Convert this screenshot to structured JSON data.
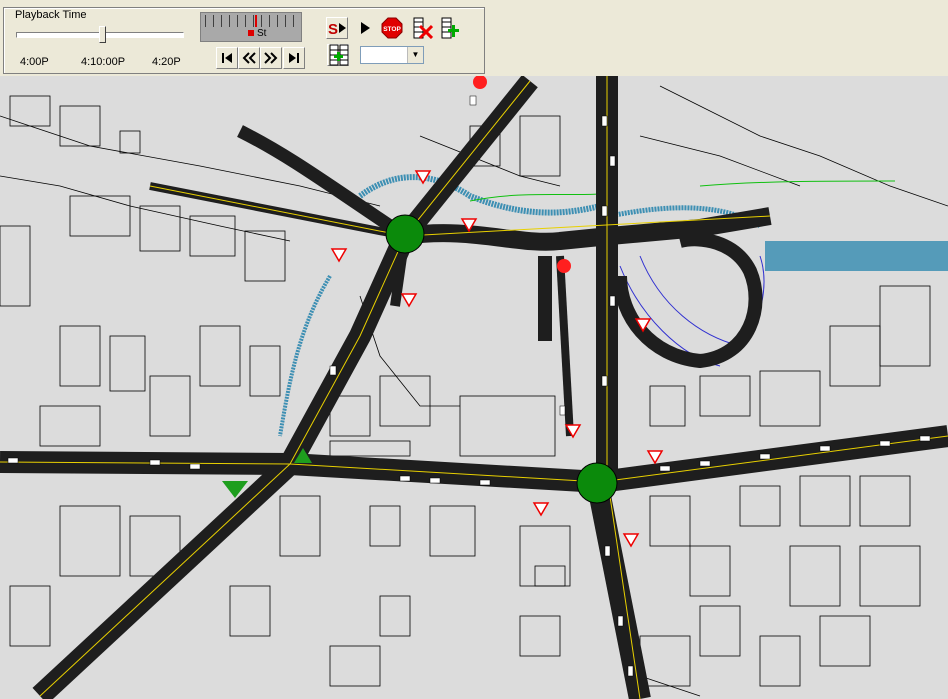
{
  "playback": {
    "group_title": "Playback Time",
    "slider_position": 0.52,
    "tick_labels": [
      "4:00P",
      "4:10:00P",
      "4:20P"
    ]
  },
  "speed": {
    "label": "St"
  },
  "buttons": {
    "step": "S",
    "stop": "STOP"
  },
  "dropdown": {
    "selected": ""
  },
  "colors": {
    "road": "#1e1e1e",
    "roundabout": "#0b8a0b",
    "map_background": "#dcdcdc",
    "building_line": "#000000",
    "lane_marking": "#e8d000",
    "water_blue": "#3d8fb3",
    "signal_red": "#ff1f1f",
    "arrow_green": "#1e9e1e"
  },
  "icons": [
    "step-play-icon",
    "play-icon",
    "stop-icon",
    "delete-frame-icon",
    "add-frame-icon",
    "first-frame-icon",
    "rewind-icon",
    "fast-forward-icon",
    "last-frame-icon",
    "grid-frame-icon"
  ]
}
